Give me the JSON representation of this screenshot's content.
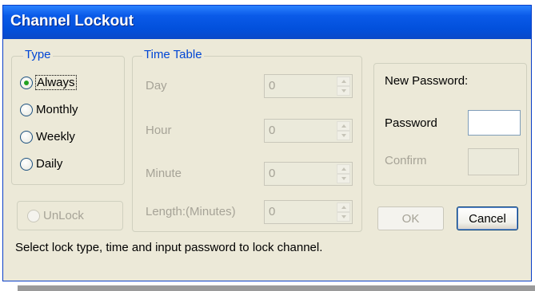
{
  "window": {
    "title": "Channel Lockout"
  },
  "type_group": {
    "legend": "Type",
    "options": [
      {
        "label": "Always",
        "checked": true
      },
      {
        "label": "Monthly",
        "checked": false
      },
      {
        "label": "Weekly",
        "checked": false
      },
      {
        "label": "Daily",
        "checked": false
      }
    ]
  },
  "unlock": {
    "label": "UnLock",
    "enabled": false
  },
  "time_table": {
    "legend": "Time Table",
    "fields": [
      {
        "label": "Day",
        "value": "0"
      },
      {
        "label": "Hour",
        "value": "0"
      },
      {
        "label": "Minute",
        "value": "0"
      },
      {
        "label": "Length:(Minutes)",
        "value": "0"
      }
    ]
  },
  "password_group": {
    "title": "New Password:",
    "password_label": "Password",
    "password_value": "",
    "confirm_label": "Confirm",
    "confirm_value": ""
  },
  "buttons": {
    "ok": "OK",
    "cancel": "Cancel"
  },
  "status_text": "Select lock type, time and input password to lock channel.",
  "colors": {
    "title_bar": "#0250dc",
    "dialog_bg": "#ece9d8",
    "legend_blue": "#0046d5",
    "radio_check": "#21a121"
  }
}
